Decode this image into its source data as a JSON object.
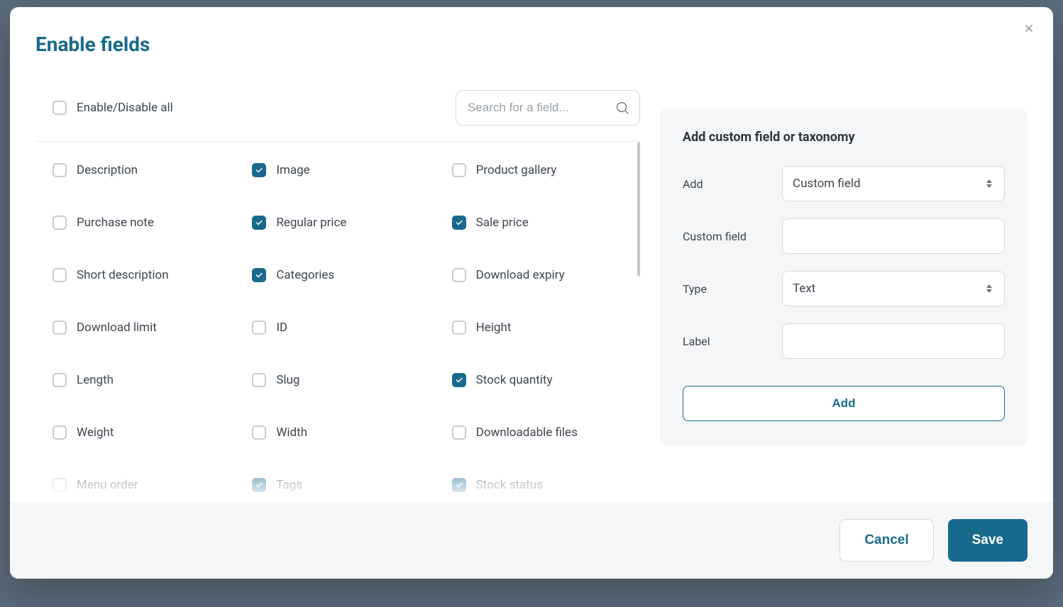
{
  "modal": {
    "title": "Enable fields",
    "enable_all_label": "Enable/Disable all",
    "search_placeholder": "Search for a field..."
  },
  "fields": [
    {
      "label": "Description",
      "checked": false
    },
    {
      "label": "Image",
      "checked": true
    },
    {
      "label": "Product gallery",
      "checked": false
    },
    {
      "label": "Purchase note",
      "checked": false
    },
    {
      "label": "Regular price",
      "checked": true
    },
    {
      "label": "Sale price",
      "checked": true
    },
    {
      "label": "Short description",
      "checked": false
    },
    {
      "label": "Categories",
      "checked": true
    },
    {
      "label": "Download expiry",
      "checked": false
    },
    {
      "label": "Download limit",
      "checked": false
    },
    {
      "label": "ID",
      "checked": false
    },
    {
      "label": "Height",
      "checked": false
    },
    {
      "label": "Length",
      "checked": false
    },
    {
      "label": "Slug",
      "checked": false
    },
    {
      "label": "Stock quantity",
      "checked": true
    },
    {
      "label": "Weight",
      "checked": false
    },
    {
      "label": "Width",
      "checked": false
    },
    {
      "label": "Downloadable files",
      "checked": false
    },
    {
      "label": "Menu order",
      "checked": false
    },
    {
      "label": "Tags",
      "checked": true
    },
    {
      "label": "Stock status",
      "checked": true
    }
  ],
  "panel": {
    "title": "Add custom field or taxonomy",
    "rows": {
      "add_label": "Add",
      "add_value": "Custom field",
      "custom_field_label": "Custom field",
      "custom_field_value": "",
      "type_label": "Type",
      "type_value": "Text",
      "label_label": "Label",
      "label_value": ""
    },
    "add_button": "Add"
  },
  "footer": {
    "cancel": "Cancel",
    "save": "Save"
  }
}
